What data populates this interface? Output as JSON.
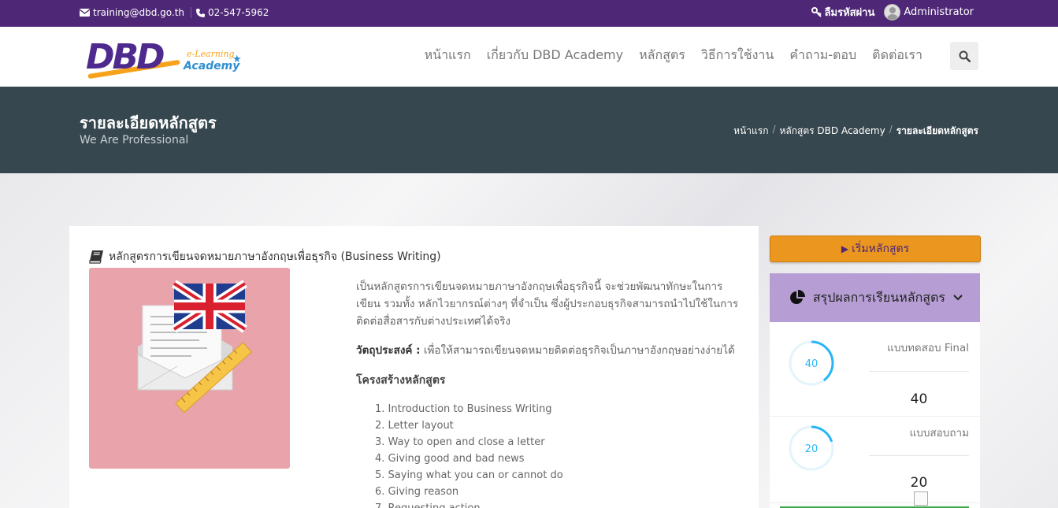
{
  "topbar": {
    "email": "training@dbd.go.th",
    "phone": "02-547-5962",
    "forgot_password": "ลืมรหัสผ่าน",
    "user": "Administrator"
  },
  "logo": {
    "main": "DBD",
    "elearning": "e-Learning",
    "academy": "Academy"
  },
  "nav": {
    "items": [
      "หน้าแรก",
      "เกี่ยวกับ DBD Academy",
      "หลักสูตร",
      "วิธีการใช้งาน",
      "คำถาม-ตอบ",
      "ติดต่อเรา"
    ]
  },
  "band": {
    "title": "รายละเอียดหลักสูตร",
    "subtitle": "We Are Professional",
    "breadcrumb": [
      "หน้าแรก",
      "หลักสูตร DBD Academy",
      "รายละเอียดหลักสูตร"
    ]
  },
  "course": {
    "title": "หลักสูตรการเขียนจดหมายภาษาอังกฤษเพื่อธุรกิจ (Business Writing)",
    "description": "เป็นหลักสูตรการเขียนจดหมายภาษาอังกฤษเพื่อธุรกิจนี้ จะช่วยพัฒนาทักษะในการเขียน รวมทั้ง หลักไวยากรณ์ต่างๆ ที่จำเป็น ซึ่งผู้ประกอบธุรกิจสามารถนำไปใช้ในการติดต่อสื่อสารกับต่างประเทศได้จริง",
    "objective_label": "วัตถุประสงค์ :",
    "objective_text": " เพื่อให้สามารถเขียนจดหมายติดต่อธุรกิจเป็นภาษาอังกฤษอย่างง่ายได้",
    "structure_title": "โครงสร้างหลักสูตร",
    "outline": [
      "1. Introduction to Business Writing",
      "2. Letter layout",
      "3. Way to open and close a letter",
      "4. Giving good and bad news",
      "5. Saying what you can or cannot do",
      "6. Giving reason",
      "7. Requesting action"
    ]
  },
  "sidebar": {
    "start_label": "เริ่มหลักสูตร",
    "summary_title": "สรุปผลการเรียนหลักสูตร",
    "scores": [
      {
        "label": "แบบทดสอบ Final",
        "circle": "40",
        "value": "40",
        "fraction": 0.4
      },
      {
        "label": "แบบสอบถาม",
        "circle": "20",
        "value": "20",
        "fraction": 0.2
      }
    ]
  },
  "colors": {
    "topbar": "#4e2776",
    "band": "#37474f",
    "accent_orange": "#eb961f",
    "summary_head": "#b69ed4",
    "ring": "#29b6f6"
  }
}
